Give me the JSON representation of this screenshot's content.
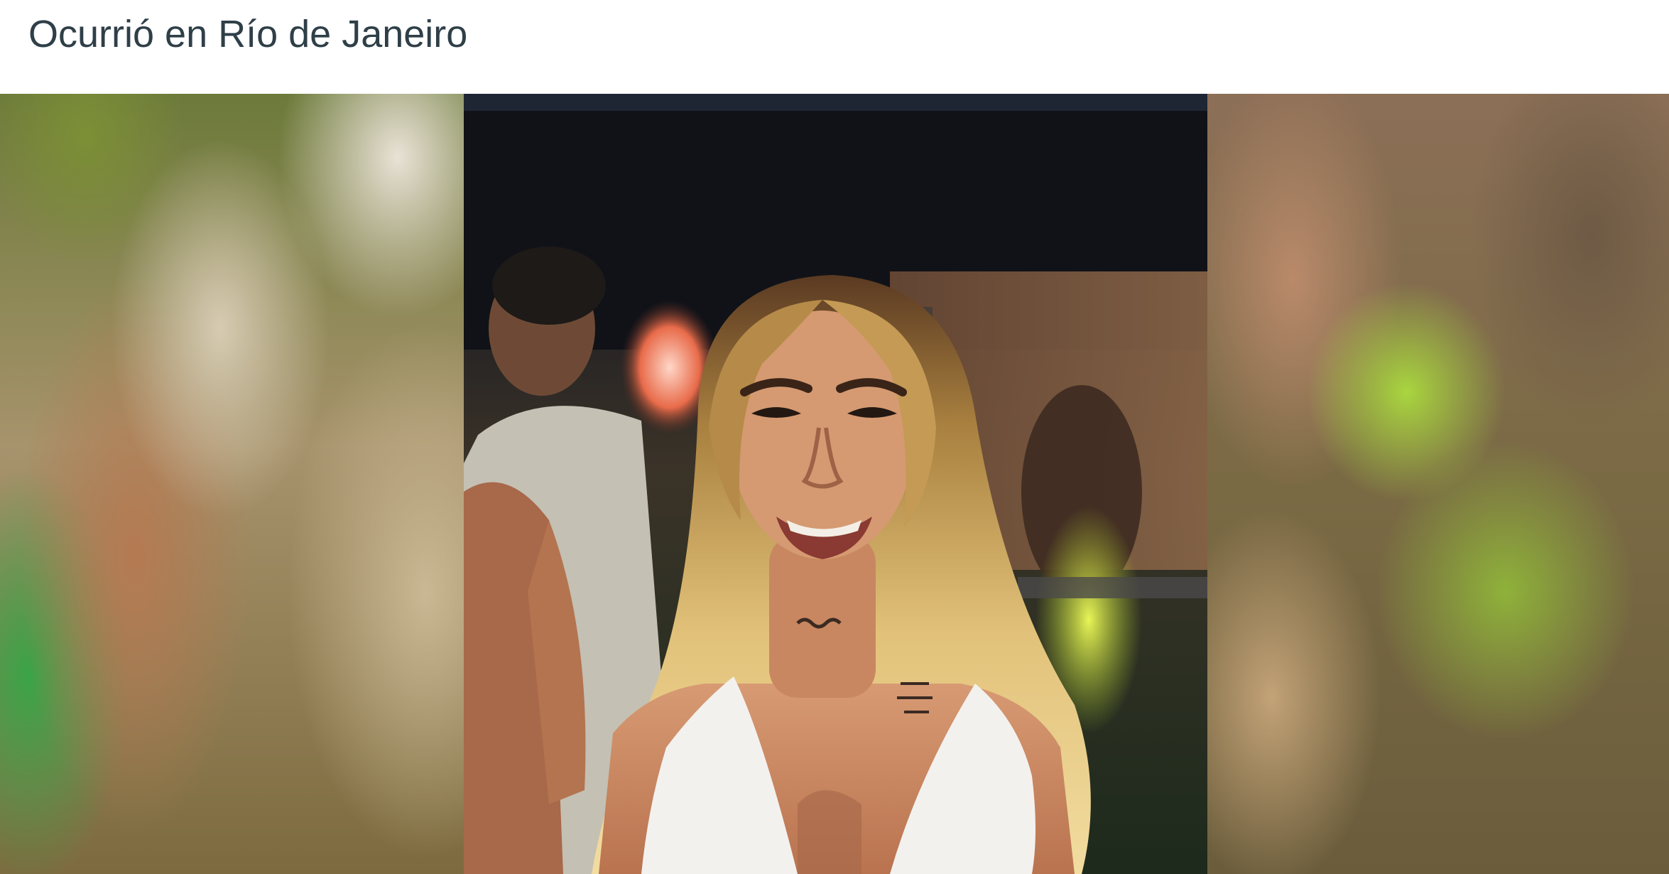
{
  "caption": {
    "text": "Ocurrió en Río de Janeiro"
  },
  "colors": {
    "caption_text": "#2f3f48",
    "page_background": "#ffffff"
  }
}
